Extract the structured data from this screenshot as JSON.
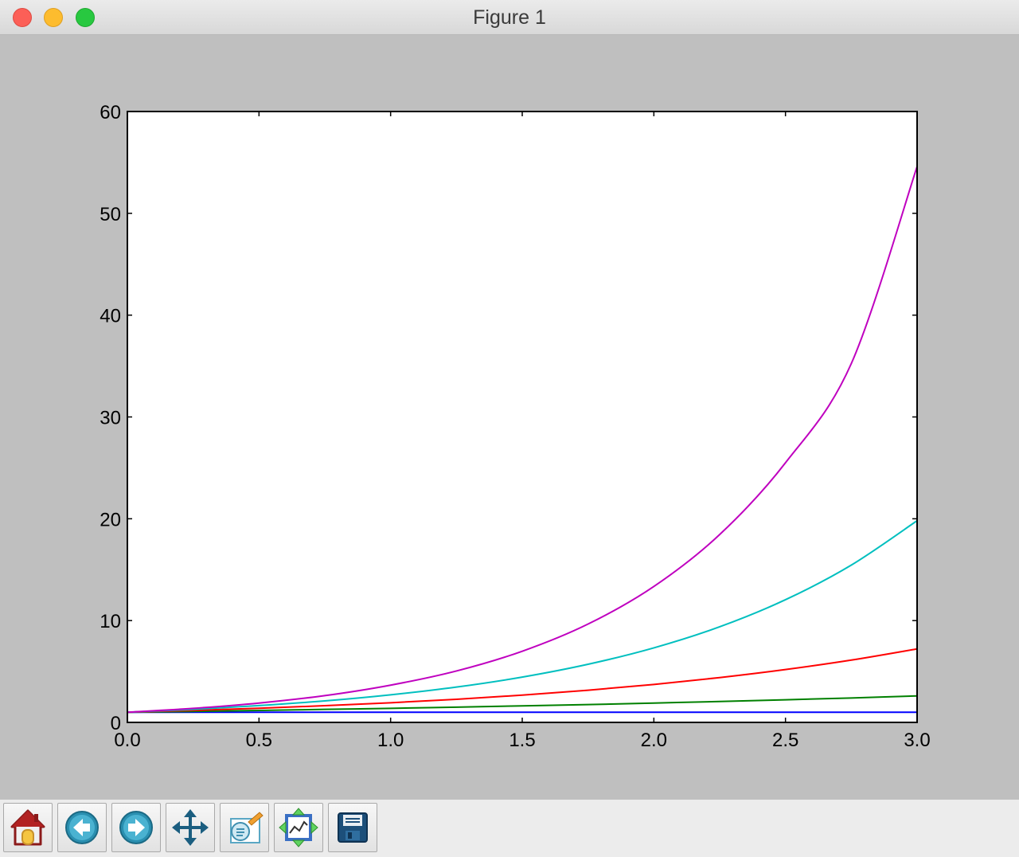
{
  "window": {
    "title": "Figure 1"
  },
  "toolbar": {
    "buttons": [
      {
        "name": "home",
        "icon": "home-icon"
      },
      {
        "name": "back",
        "icon": "back-arrow-icon"
      },
      {
        "name": "forward",
        "icon": "forward-arrow-icon"
      },
      {
        "name": "pan",
        "icon": "pan-arrows-icon"
      },
      {
        "name": "zoom",
        "icon": "zoom-rect-icon"
      },
      {
        "name": "configure-subplots",
        "icon": "subplots-icon"
      },
      {
        "name": "save",
        "icon": "floppy-disk-icon"
      }
    ]
  },
  "chart_data": {
    "type": "line",
    "title": "",
    "xlabel": "",
    "ylabel": "",
    "xlim": [
      0.0,
      3.0
    ],
    "ylim": [
      0,
      60
    ],
    "xticks": [
      "0.0",
      "0.5",
      "1.0",
      "1.5",
      "2.0",
      "2.5",
      "3.0"
    ],
    "yticks": [
      "0",
      "10",
      "20",
      "30",
      "40",
      "50",
      "60"
    ],
    "grid": false,
    "legend": "none",
    "x": [
      0.0,
      0.25,
      0.5,
      0.75,
      1.0,
      1.25,
      1.5,
      1.75,
      2.0,
      2.25,
      2.5,
      2.75,
      3.0
    ],
    "series": [
      {
        "color": "#0000ff",
        "values": [
          1.0,
          1.0,
          1.0,
          1.0,
          1.0,
          1.0,
          1.0,
          1.0,
          1.0,
          1.0,
          1.0,
          1.0,
          1.0
        ]
      },
      {
        "color": "#008000",
        "values": [
          1.0,
          1.08,
          1.17,
          1.28,
          1.38,
          1.5,
          1.62,
          1.75,
          1.9,
          2.05,
          2.22,
          2.4,
          2.6
        ]
      },
      {
        "color": "#ff0000",
        "values": [
          1.0,
          1.18,
          1.39,
          1.64,
          1.93,
          2.27,
          2.68,
          3.16,
          3.73,
          4.4,
          5.19,
          6.12,
          7.22
        ]
      },
      {
        "color": "#00bfbf",
        "values": [
          1.0,
          1.28,
          1.65,
          2.11,
          2.71,
          3.47,
          4.45,
          5.71,
          7.32,
          9.39,
          12.05,
          15.45,
          19.81
        ]
      },
      {
        "color": "#bf00bf",
        "values": [
          1.0,
          1.38,
          1.9,
          2.63,
          3.66,
          5.05,
          6.99,
          9.66,
          13.35,
          18.45,
          25.5,
          35.24,
          54.6
        ]
      }
    ]
  }
}
